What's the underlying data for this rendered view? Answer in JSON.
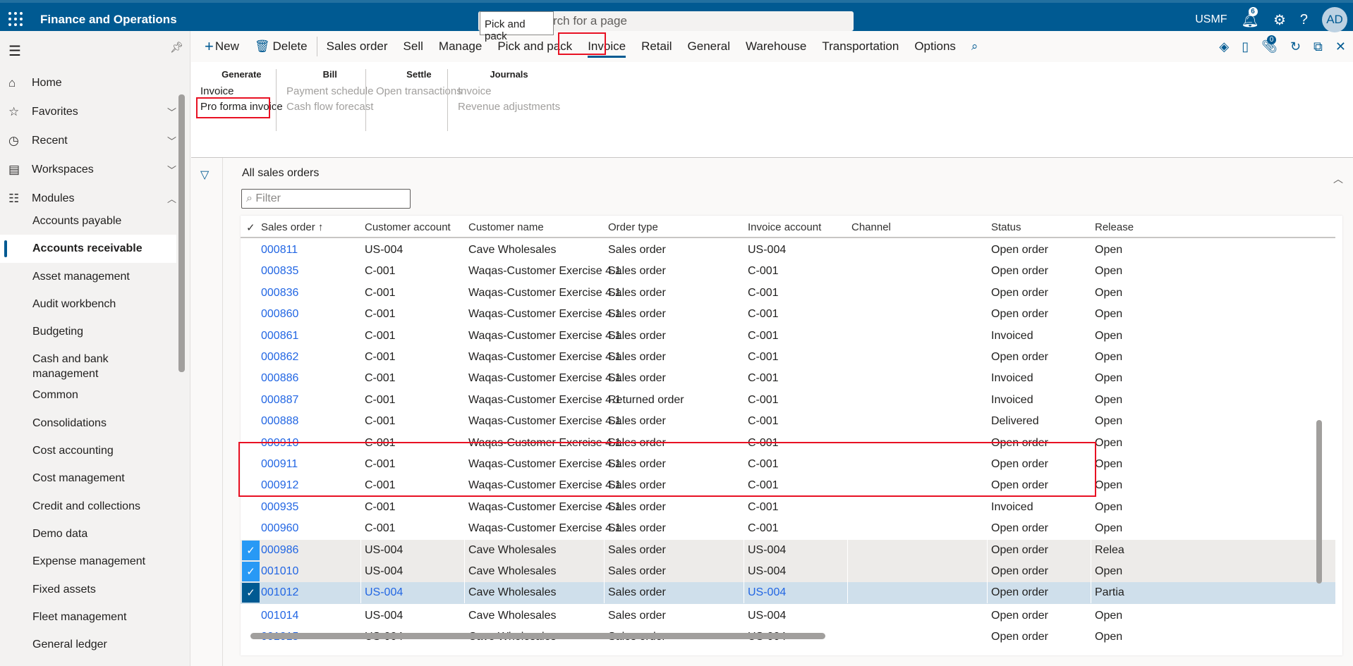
{
  "app": {
    "title": "Finance and Operations",
    "search_placeholder": "Search for a page",
    "search_visible_text": "rch for a page",
    "tooltip": "Pick and pack",
    "company": "USMF",
    "notifications_count": "6",
    "avatar_initials": "AD",
    "brand_color": "#005a92"
  },
  "sidebar": {
    "nav": [
      {
        "label": "Home",
        "icon": "home-icon",
        "chevron": ""
      },
      {
        "label": "Favorites",
        "icon": "star-icon",
        "chevron": "down"
      },
      {
        "label": "Recent",
        "icon": "clock-icon",
        "chevron": "down"
      },
      {
        "label": "Workspaces",
        "icon": "workspace-icon",
        "chevron": "down"
      },
      {
        "label": "Modules",
        "icon": "modules-icon",
        "chevron": "up"
      }
    ],
    "modules": [
      "Accounts payable",
      "Accounts receivable",
      "Asset management",
      "Audit workbench",
      "Budgeting",
      "Cash and bank management",
      "Common",
      "Consolidations",
      "Cost accounting",
      "Cost management",
      "Credit and collections",
      "Demo data",
      "Expense management",
      "Fixed assets",
      "Fleet management",
      "General ledger"
    ],
    "active_module": "Accounts receivable"
  },
  "actionbar": {
    "new": "New",
    "delete": "Delete",
    "tabs": [
      "Sales order",
      "Sell",
      "Manage",
      "Pick and pack",
      "Invoice",
      "Retail",
      "General",
      "Warehouse",
      "Transportation",
      "Options"
    ],
    "selected_tab": "Invoice",
    "attachments_count": "0"
  },
  "ribbon": {
    "groups": [
      {
        "header": "Generate",
        "items": [
          {
            "label": "Invoice",
            "enabled": true
          },
          {
            "label": "Pro forma invoice",
            "enabled": true
          }
        ]
      },
      {
        "header": "Bill",
        "items": [
          {
            "label": "Payment schedule",
            "enabled": false
          },
          {
            "label": "Cash flow forecast",
            "enabled": false
          }
        ]
      },
      {
        "header": "Settle",
        "items": [
          {
            "label": "Open transactions",
            "enabled": false
          }
        ]
      },
      {
        "header": "Journals",
        "items": [
          {
            "label": "Invoice",
            "enabled": false
          },
          {
            "label": "Revenue adjustments",
            "enabled": false
          }
        ]
      }
    ]
  },
  "page": {
    "title": "All sales orders",
    "filter_placeholder": "Filter"
  },
  "grid": {
    "columns": [
      "Sales order",
      "Customer account",
      "Customer name",
      "Order type",
      "Invoice account",
      "Channel",
      "Status",
      "Release"
    ],
    "sort_indicator": "↑",
    "rows": [
      {
        "so": "000811",
        "acct": "US-004",
        "name": "Cave Wholesales",
        "type": "Sales order",
        "inv": "US-004",
        "channel": "",
        "status": "Open order",
        "release": "Open",
        "state": ""
      },
      {
        "so": "000835",
        "acct": "C-001",
        "name": "Waqas-Customer Exercise 4.1",
        "type": "Sales order",
        "inv": "C-001",
        "channel": "",
        "status": "Open order",
        "release": "Open",
        "state": ""
      },
      {
        "so": "000836",
        "acct": "C-001",
        "name": "Waqas-Customer Exercise 4.1",
        "type": "Sales order",
        "inv": "C-001",
        "channel": "",
        "status": "Open order",
        "release": "Open",
        "state": ""
      },
      {
        "so": "000860",
        "acct": "C-001",
        "name": "Waqas-Customer Exercise 4.1",
        "type": "Sales order",
        "inv": "C-001",
        "channel": "",
        "status": "Open order",
        "release": "Open",
        "state": ""
      },
      {
        "so": "000861",
        "acct": "C-001",
        "name": "Waqas-Customer Exercise 4.1",
        "type": "Sales order",
        "inv": "C-001",
        "channel": "",
        "status": "Invoiced",
        "release": "Open",
        "state": ""
      },
      {
        "so": "000862",
        "acct": "C-001",
        "name": "Waqas-Customer Exercise 4.1",
        "type": "Sales order",
        "inv": "C-001",
        "channel": "",
        "status": "Open order",
        "release": "Open",
        "state": ""
      },
      {
        "so": "000886",
        "acct": "C-001",
        "name": "Waqas-Customer Exercise 4.1",
        "type": "Sales order",
        "inv": "C-001",
        "channel": "",
        "status": "Invoiced",
        "release": "Open",
        "state": ""
      },
      {
        "so": "000887",
        "acct": "C-001",
        "name": "Waqas-Customer Exercise 4.1",
        "type": "Returned order",
        "inv": "C-001",
        "channel": "",
        "status": "Invoiced",
        "release": "Open",
        "state": ""
      },
      {
        "so": "000888",
        "acct": "C-001",
        "name": "Waqas-Customer Exercise 4.1",
        "type": "Sales order",
        "inv": "C-001",
        "channel": "",
        "status": "Delivered",
        "release": "Open",
        "state": ""
      },
      {
        "so": "000910",
        "acct": "C-001",
        "name": "Waqas-Customer Exercise 4.1",
        "type": "Sales order",
        "inv": "C-001",
        "channel": "",
        "status": "Open order",
        "release": "Open",
        "state": ""
      },
      {
        "so": "000911",
        "acct": "C-001",
        "name": "Waqas-Customer Exercise 4.1",
        "type": "Sales order",
        "inv": "C-001",
        "channel": "",
        "status": "Open order",
        "release": "Open",
        "state": ""
      },
      {
        "so": "000912",
        "acct": "C-001",
        "name": "Waqas-Customer Exercise 4.1",
        "type": "Sales order",
        "inv": "C-001",
        "channel": "",
        "status": "Open order",
        "release": "Open",
        "state": ""
      },
      {
        "so": "000935",
        "acct": "C-001",
        "name": "Waqas-Customer Exercise 4.1",
        "type": "Sales order",
        "inv": "C-001",
        "channel": "",
        "status": "Invoiced",
        "release": "Open",
        "state": ""
      },
      {
        "so": "000960",
        "acct": "C-001",
        "name": "Waqas-Customer Exercise 4.1",
        "type": "Sales order",
        "inv": "C-001",
        "channel": "",
        "status": "Open order",
        "release": "Open",
        "state": ""
      },
      {
        "so": "000986",
        "acct": "US-004",
        "name": "Cave Wholesales",
        "type": "Sales order",
        "inv": "US-004",
        "channel": "",
        "status": "Open order",
        "release": "Releas",
        "state": "checked"
      },
      {
        "so": "001010",
        "acct": "US-004",
        "name": "Cave Wholesales",
        "type": "Sales order",
        "inv": "US-004",
        "channel": "",
        "status": "Open order",
        "release": "Open",
        "state": "checked"
      },
      {
        "so": "001012",
        "acct": "US-004",
        "name": "Cave Wholesales",
        "type": "Sales order",
        "inv": "US-004",
        "channel": "",
        "status": "Open order",
        "release": "Partiall",
        "state": "current"
      },
      {
        "so": "001014",
        "acct": "US-004",
        "name": "Cave Wholesales",
        "type": "Sales order",
        "inv": "US-004",
        "channel": "",
        "status": "Open order",
        "release": "Open",
        "state": ""
      },
      {
        "so": "001015",
        "acct": "US-004",
        "name": "Cave Wholesales",
        "type": "Sales order",
        "inv": "US-004",
        "channel": "",
        "status": "Open order",
        "release": "Open",
        "state": ""
      }
    ]
  }
}
